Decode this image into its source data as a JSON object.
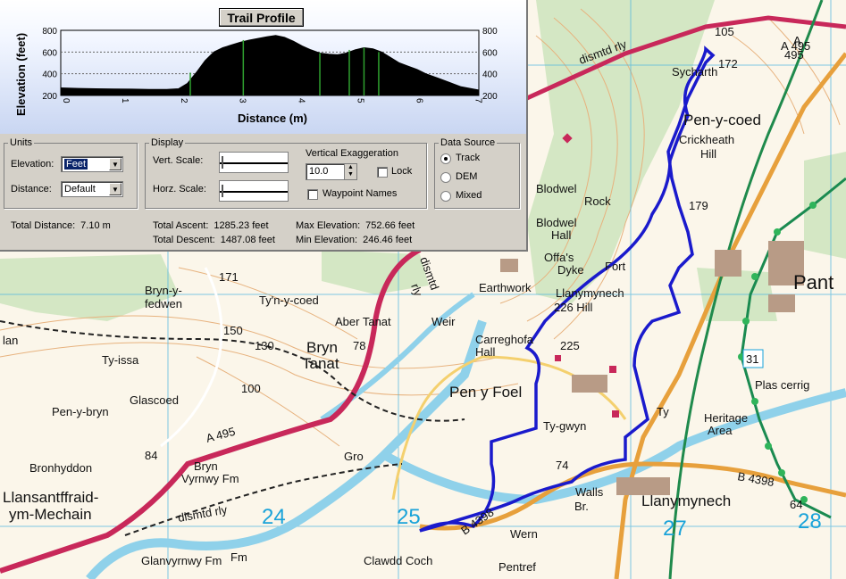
{
  "panel": {
    "title": "Trail Profile",
    "y_axis_label": "Elevation (feet)",
    "x_axis_label": "Distance (m)",
    "y_ticks": [
      "800",
      "600",
      "400",
      "200"
    ],
    "y_ticks_right": [
      "800",
      "600",
      "400",
      "200"
    ],
    "x_ticks": [
      "0",
      "1",
      "2",
      "3",
      "4",
      "5",
      "6",
      "7"
    ],
    "units": {
      "legend": "Units",
      "elevation_label": "Elevation:",
      "elevation_value": "Feet",
      "distance_label": "Distance:",
      "distance_value": "Default"
    },
    "display": {
      "legend": "Display",
      "vert_scale_label": "Vert. Scale:",
      "horz_scale_label": "Horz. Scale:",
      "vertical_exaggeration_label": "Vertical Exaggeration",
      "vertical_exaggeration_value": "10.0",
      "lock_label": "Lock",
      "waypoint_names_label": "Waypoint Names"
    },
    "data_source": {
      "legend": "Data Source",
      "options": [
        "Track",
        "DEM",
        "Mixed"
      ],
      "selected": "Track"
    },
    "stats": {
      "total_distance_label": "Total Distance:",
      "total_distance_value": "7.10 m",
      "total_ascent_label": "Total Ascent:",
      "total_ascent_value": "1285.23 feet",
      "total_descent_label": "Total Descent:",
      "total_descent_value": "1487.08 feet",
      "max_elevation_label": "Max Elevation:",
      "max_elevation_value": "752.66 feet",
      "min_elevation_label": "Min Elevation:",
      "min_elevation_value": "246.46 feet"
    }
  },
  "profile_chart": {
    "type": "area",
    "x_range": [
      0,
      7.1
    ],
    "y_range": [
      200,
      800
    ],
    "x": [
      0,
      0.3,
      0.6,
      0.9,
      1.2,
      1.5,
      1.8,
      2.0,
      2.15,
      2.3,
      2.45,
      2.6,
      2.75,
      2.9,
      3.05,
      3.2,
      3.35,
      3.5,
      3.65,
      3.8,
      3.95,
      4.1,
      4.25,
      4.4,
      4.55,
      4.7,
      4.85,
      5.0,
      5.15,
      5.3,
      5.45,
      5.6,
      5.75,
      5.9,
      6.05,
      6.2,
      6.4,
      6.6,
      6.8,
      7.0,
      7.1
    ],
    "y": [
      270,
      265,
      262,
      260,
      258,
      256,
      255,
      262,
      310,
      410,
      520,
      600,
      640,
      665,
      690,
      710,
      725,
      740,
      752,
      735,
      700,
      655,
      620,
      590,
      580,
      575,
      590,
      620,
      640,
      630,
      600,
      550,
      500,
      470,
      440,
      400,
      360,
      320,
      280,
      260,
      250
    ],
    "line_color": "#000000",
    "fill_color": "#000000",
    "marker_color": "#2fa12f",
    "marker_x": [
      2.2,
      3.1,
      4.4,
      4.9,
      5.15,
      5.4
    ]
  },
  "map": {
    "labels": [
      "Pen-y-coed",
      "Crickheath",
      "Hill",
      "Blodwel",
      "Rock",
      "Blodwel",
      "Hall",
      "Offa's",
      "Dyke",
      "Fort",
      "Llanymynech",
      "226 Hill",
      "Earthwork",
      "Pant",
      "Plas cerrig",
      "Heritage",
      "Area",
      "Bryn-y-",
      "fedwen",
      "Ty'n-y-coed",
      "Aber Tanat",
      "Weir",
      "Carreghofa",
      "Hall",
      "Bryn",
      "Tanat",
      "Pen y Foel",
      "Ty-gwyn",
      "Llanymynech",
      "Walls",
      "Br.",
      "Glascoed",
      "Pen-y-bryn",
      "Bronhyddon",
      "Bryn",
      "Vyrnwy Fm",
      "Llansantffraid-",
      "ym-Mechain",
      "Glanvyrnwy Fm",
      "Clawdd Coch",
      "Pentref",
      "Wern",
      "Gro",
      "Ty-issa",
      "lan",
      "dismtd rly",
      "dismtd rly",
      "dismtd",
      "rly",
      "Sycharth",
      "A 495",
      "A 495",
      "B 4398",
      "B 4398",
      "Fm",
      "Ty"
    ],
    "heights": [
      "171",
      "78",
      "84",
      "179",
      "172",
      "105",
      "225",
      "74",
      "64",
      "150",
      "130",
      "100"
    ],
    "grid_numbers": [
      "24",
      "25",
      "27",
      "28"
    ],
    "road_numbers": [
      "A",
      "495",
      "31"
    ],
    "colors": {
      "track": "#1a1acc",
      "a_road": "#c8285a",
      "b_road": "#e0a040",
      "river": "#8fd1ea",
      "green_route": "#1a8a50",
      "grid": "#4ab4e0"
    }
  }
}
